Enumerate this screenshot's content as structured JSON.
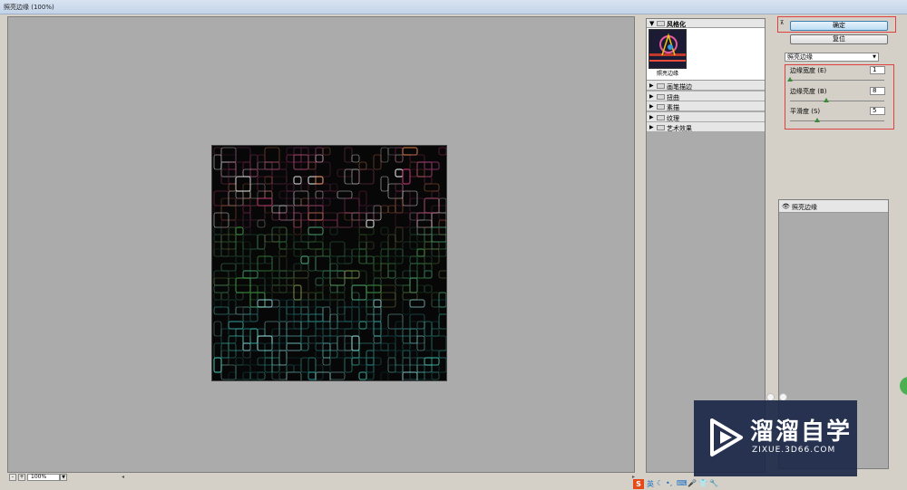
{
  "window": {
    "title": "照亮边缘 (100%)"
  },
  "zoom": {
    "minus_label": "-",
    "plus_label": "+",
    "value": "100%"
  },
  "gallery": {
    "open_category": "风格化",
    "open_thumbnail_label": "照亮边缘",
    "categories": [
      "画笔描边",
      "扭曲",
      "素描",
      "纹理",
      "艺术效果"
    ]
  },
  "buttons": {
    "ok": "确定",
    "reset": "复位"
  },
  "filter_select": {
    "value": "照亮边缘"
  },
  "params": [
    {
      "label": "边缘宽度 (E)",
      "value": "1",
      "fraction": 0.0
    },
    {
      "label": "边缘亮度 (B)",
      "value": "8",
      "fraction": 0.4
    },
    {
      "label": "平滑度 (S)",
      "value": "5",
      "fraction": 0.3
    }
  ],
  "layers": {
    "effect_layer": "照亮边缘"
  },
  "watermark": {
    "title": "溜溜自学",
    "url": "ZIXUE.3D66.COM"
  },
  "taskbar": {
    "ime_label": "英"
  },
  "colors": {
    "accent_red": "#e04040",
    "watermark_bg": "#1a2746",
    "ok_button": "#bcdcf4"
  }
}
